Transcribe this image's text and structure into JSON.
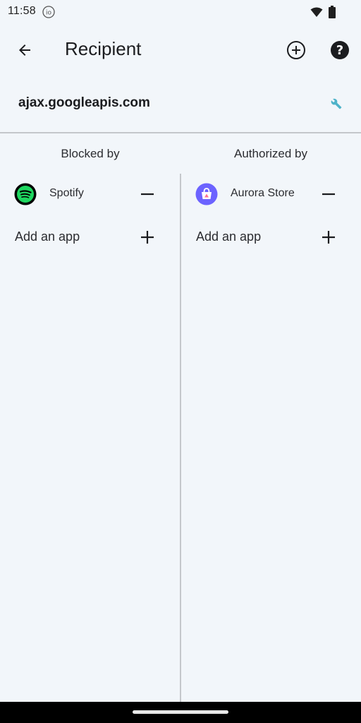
{
  "status_bar": {
    "time": "11:58",
    "io_indicator": "io",
    "icons": [
      "wifi-icon",
      "battery-icon"
    ]
  },
  "app_bar": {
    "title": "Recipient",
    "back_icon": "arrow-back-icon",
    "add_icon": "add-circle-icon",
    "help_icon": "help-icon"
  },
  "recipient": {
    "domain": "ajax.googleapis.com",
    "settings_icon": "wrench-icon",
    "accent_color": "#4fb3c9"
  },
  "blocked": {
    "header": "Blocked by",
    "apps": [
      {
        "name": "Spotify",
        "icon": "spotify-icon",
        "color": "#1ed760"
      }
    ],
    "add_label": "Add an app"
  },
  "authorized": {
    "header": "Authorized by",
    "apps": [
      {
        "name": "Aurora Store",
        "icon": "aurora-store-icon",
        "color": "#6c63ff"
      }
    ],
    "add_label": "Add an app"
  },
  "colors": {
    "background": "#f2f6fa",
    "divider": "#c4c7cb",
    "text": "#1b1c1f"
  }
}
